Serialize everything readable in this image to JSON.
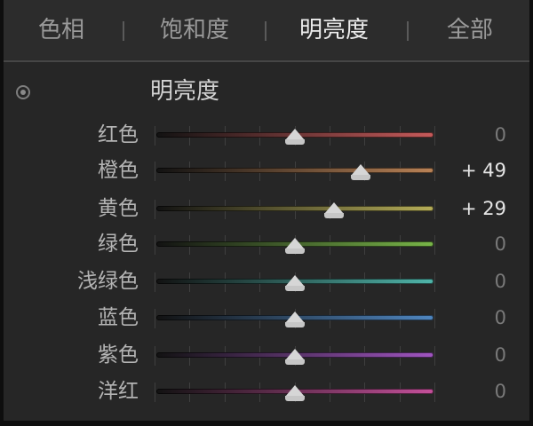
{
  "tabs": [
    {
      "label": "色相",
      "active": false
    },
    {
      "label": "饱和度",
      "active": false
    },
    {
      "label": "明亮度",
      "active": true
    },
    {
      "label": "全部",
      "active": false
    }
  ],
  "panel": {
    "title": "明亮度",
    "target_icon": "target-adjust-icon",
    "sliders": [
      {
        "label": "红色",
        "value": "0",
        "numeric": 0,
        "left_color": "#121212",
        "right_color": "#c65a5a"
      },
      {
        "label": "橙色",
        "value": "+ 49",
        "numeric": 49,
        "left_color": "#121212",
        "right_color": "#b98256"
      },
      {
        "label": "黄色",
        "value": "+ 29",
        "numeric": 29,
        "left_color": "#121212",
        "right_color": "#b5ad58"
      },
      {
        "label": "绿色",
        "value": "0",
        "numeric": 0,
        "left_color": "#121212",
        "right_color": "#78b548"
      },
      {
        "label": "浅绿色",
        "value": "0",
        "numeric": 0,
        "left_color": "#121212",
        "right_color": "#4fb5aa"
      },
      {
        "label": "蓝色",
        "value": "0",
        "numeric": 0,
        "left_color": "#121212",
        "right_color": "#4f86c0"
      },
      {
        "label": "紫色",
        "value": "0",
        "numeric": 0,
        "left_color": "#121212",
        "right_color": "#a055c1"
      },
      {
        "label": "洋红",
        "value": "0",
        "numeric": 0,
        "left_color": "#121212",
        "right_color": "#c4509a"
      }
    ],
    "slider_range": [
      -100,
      100
    ]
  }
}
